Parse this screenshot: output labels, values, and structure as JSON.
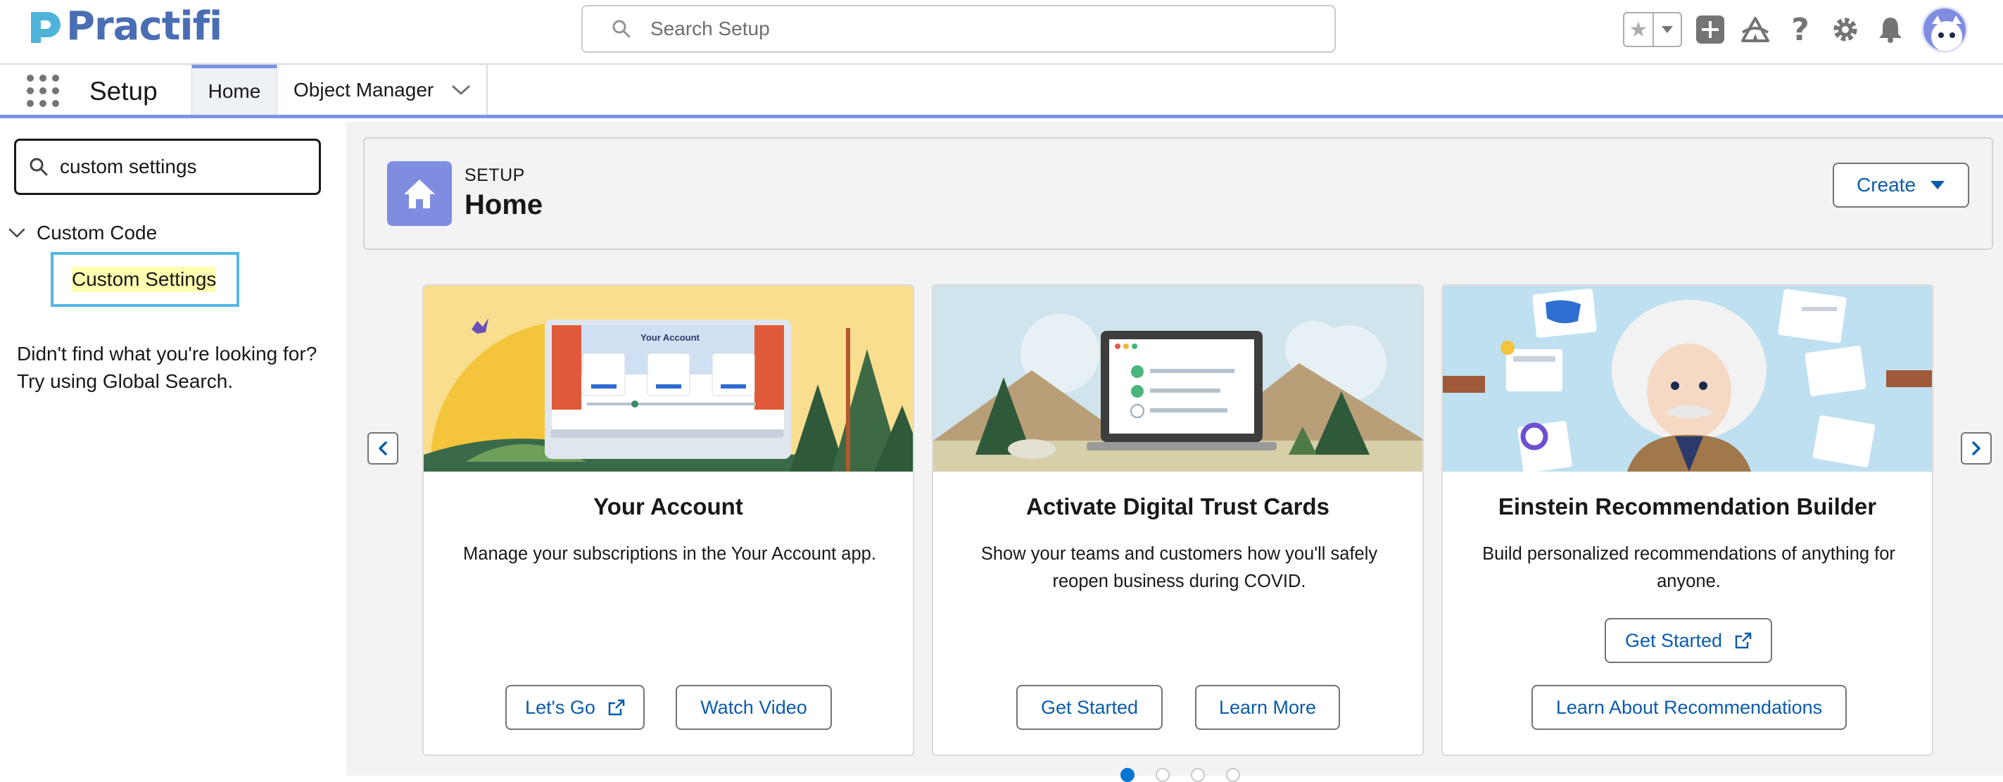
{
  "brand": {
    "name": "Practifi"
  },
  "header": {
    "search_placeholder": "Search Setup",
    "icons": [
      "favorites-star-icon",
      "favorites-dropdown-icon",
      "global-actions-icon",
      "trailhead-icon",
      "help-icon",
      "setup-gear-icon",
      "notifications-bell-icon",
      "user-avatar"
    ]
  },
  "nav": {
    "app_name": "Setup",
    "tabs": [
      {
        "label": "Home",
        "active": true
      },
      {
        "label": "Object Manager",
        "active": false
      }
    ]
  },
  "sidebar": {
    "quick_find_value": "custom settings",
    "tree": {
      "section": "Custom Code",
      "items": [
        {
          "label": "Custom Settings",
          "highlighted": true
        }
      ]
    },
    "not_found_line1": "Didn't find what you're looking for?",
    "not_found_line2": "Try using Global Search."
  },
  "page_header": {
    "eyebrow": "SETUP",
    "title": "Home",
    "create_label": "Create"
  },
  "cards": [
    {
      "title": "Your Account",
      "description": "Manage your subscriptions in the Your Account app.",
      "illustration_text": "Your Account",
      "buttons": [
        {
          "label": "Let's Go",
          "external": true
        },
        {
          "label": "Watch Video",
          "external": false
        }
      ]
    },
    {
      "title": "Activate Digital Trust Cards",
      "description": "Show your teams and customers how you'll safely reopen business during COVID.",
      "buttons": [
        {
          "label": "Get Started",
          "external": false
        },
        {
          "label": "Learn More",
          "external": false
        }
      ]
    },
    {
      "title": "Einstein Recommendation Builder",
      "description": "Build personalized recommendations of anything for anyone.",
      "buttons": [
        {
          "label": "Get Started",
          "external": true
        },
        {
          "label": "Learn About Recommendations",
          "external": false
        }
      ]
    }
  ],
  "carousel": {
    "dot_count": 4,
    "active_index": 0
  },
  "colors": {
    "brand_blue": "#4a6eb3",
    "nav_accent": "#7b94e4",
    "link_blue": "#0b5cab",
    "home_icon_bg": "#7f8de1",
    "highlight": "#ffffb2",
    "focus_border": "#52b6e5"
  }
}
